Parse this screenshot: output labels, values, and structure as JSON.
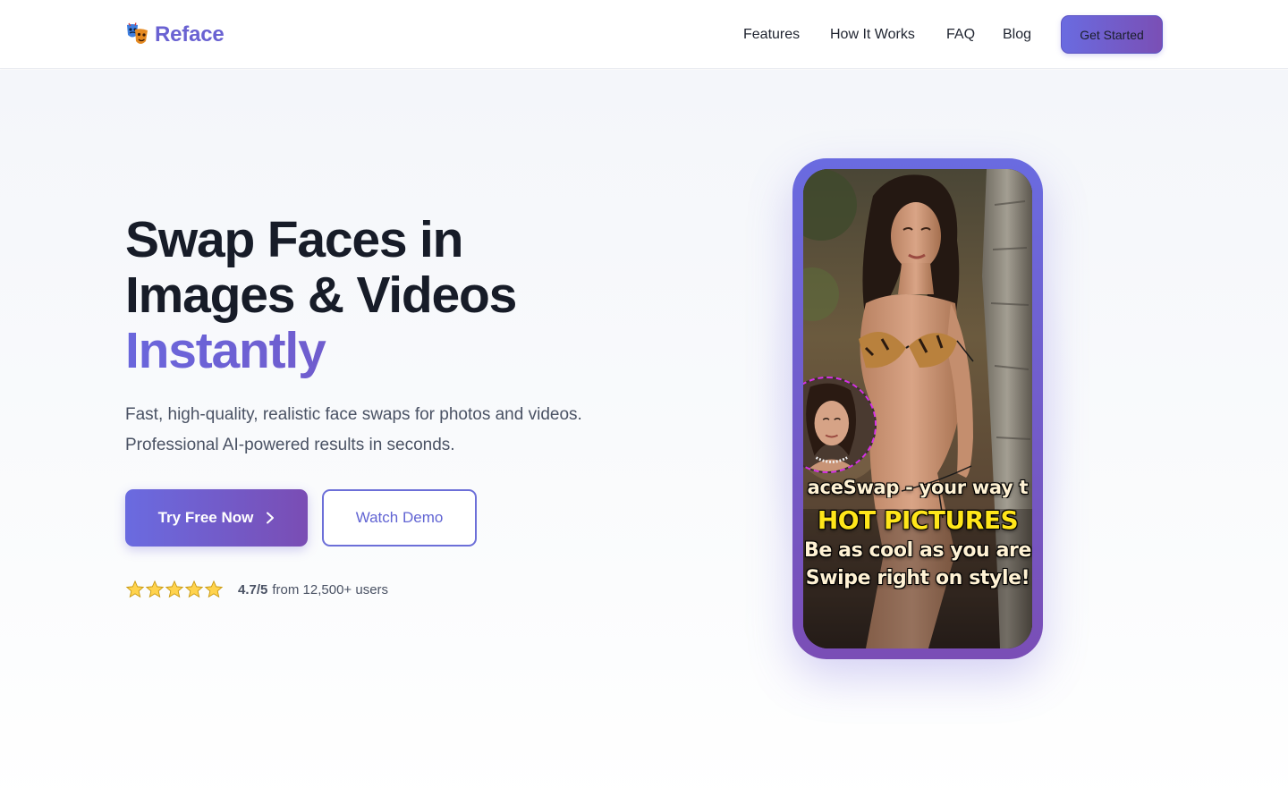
{
  "brand": {
    "name": "Reface",
    "logo_icon": "masks-icon",
    "color": "#6a62d2"
  },
  "nav": {
    "items": [
      {
        "label": "Features"
      },
      {
        "label": "How It Works"
      },
      {
        "label": "FAQ"
      },
      {
        "label": "Blog"
      }
    ],
    "cta_label": "Get Started"
  },
  "hero": {
    "headline_line1": "Swap Faces in",
    "headline_line2": "Images & Videos",
    "headline_accent": "Instantly",
    "subtext_line1": "Fast, high-quality, realistic face swaps for photos and videos.",
    "subtext_line2": "Professional AI-powered results in seconds.",
    "primary_button": "Try Free Now",
    "secondary_button": "Watch Demo",
    "rating": {
      "stars": 5,
      "score": "4.7/5",
      "text": "from 12,500+ users"
    }
  },
  "phone_preview": {
    "caption_line1": "aceSwap - your way t",
    "caption_line2": "HOT PICTURES",
    "caption_line3": "Be as cool as you are",
    "caption_line4": "Swipe right on style!"
  },
  "colors": {
    "accent_start": "#6a6be0",
    "accent_end": "#7a4eb6",
    "text_dark": "#171c28",
    "text_muted": "#4a5264",
    "caption_highlight": "#ffe61a"
  }
}
